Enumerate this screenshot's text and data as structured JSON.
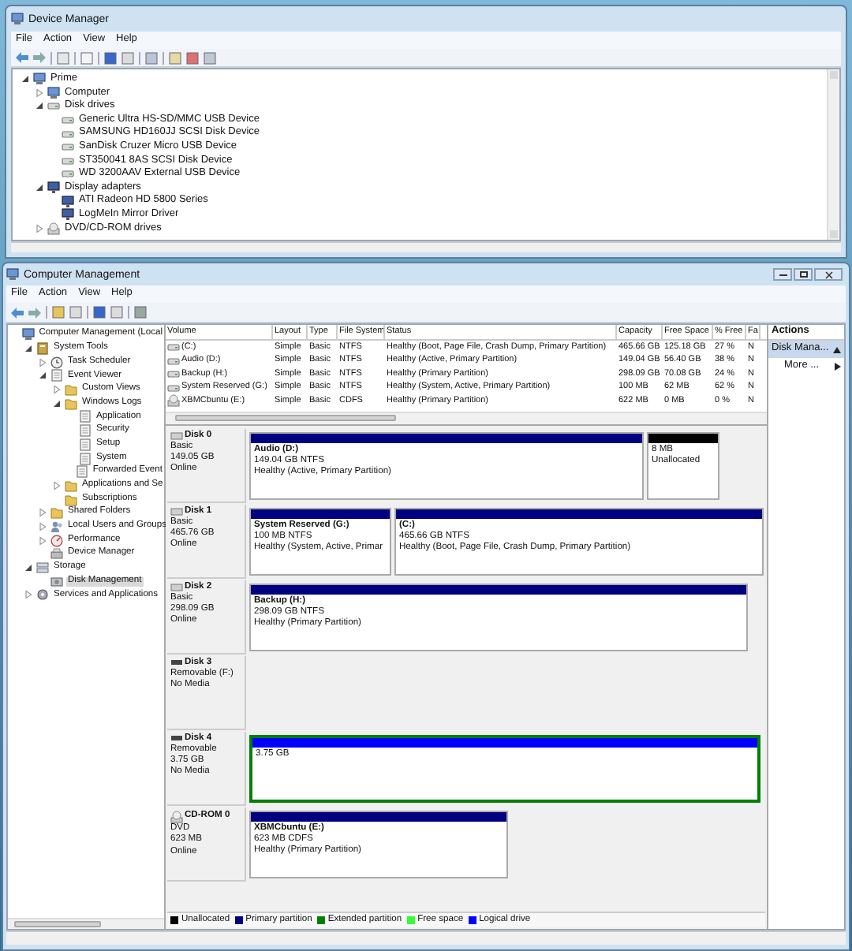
{
  "device_manager": {
    "title": "Device Manager",
    "menu": [
      "File",
      "Action",
      "View",
      "Help"
    ],
    "tree": [
      {
        "label": "Prime",
        "kind": "computer",
        "expanded": true,
        "children": [
          {
            "label": "Computer",
            "kind": "computer",
            "expanded": false
          },
          {
            "label": "Disk drives",
            "kind": "drive",
            "expanded": true,
            "children": [
              {
                "label": "Generic Ultra HS-SD/MMC USB Device",
                "kind": "drive"
              },
              {
                "label": "SAMSUNG HD160JJ SCSI Disk Device",
                "kind": "drive"
              },
              {
                "label": "SanDisk Cruzer Micro USB Device",
                "kind": "drive"
              },
              {
                "label": "ST350041 8AS SCSI Disk Device",
                "kind": "drive"
              },
              {
                "label": "WD 3200AAV External USB Device",
                "kind": "drive"
              }
            ]
          },
          {
            "label": "Display adapters",
            "kind": "monitor",
            "expanded": true,
            "children": [
              {
                "label": "ATI Radeon HD 5800 Series",
                "kind": "monitor"
              },
              {
                "label": "LogMeIn Mirror Driver",
                "kind": "monitor"
              }
            ]
          },
          {
            "label": "DVD/CD-ROM drives",
            "kind": "cdrom",
            "expanded": false
          }
        ]
      }
    ]
  },
  "computer_management": {
    "title": "Computer Management",
    "menu": [
      "File",
      "Action",
      "View",
      "Help"
    ],
    "tree": [
      {
        "label": "Computer Management (Local",
        "kind": "computer",
        "selected": false,
        "children": [
          {
            "label": "System Tools",
            "kind": "tools",
            "expanded": true,
            "selected": false,
            "children": [
              {
                "label": "Task Scheduler",
                "kind": "clock",
                "expanded": false,
                "selected": false
              },
              {
                "label": "Event Viewer",
                "kind": "log",
                "expanded": true,
                "selected": false,
                "children": [
                  {
                    "label": "Custom Views",
                    "kind": "folder",
                    "expanded": false,
                    "selected": false
                  },
                  {
                    "label": "Windows Logs",
                    "kind": "folder",
                    "expanded": true,
                    "selected": false,
                    "children": [
                      {
                        "label": "Application",
                        "kind": "log",
                        "selected": false
                      },
                      {
                        "label": "Security",
                        "kind": "log",
                        "selected": false
                      },
                      {
                        "label": "Setup",
                        "kind": "log",
                        "selected": false
                      },
                      {
                        "label": "System",
                        "kind": "log",
                        "selected": false
                      },
                      {
                        "label": "Forwarded Event",
                        "kind": "log",
                        "selected": false
                      }
                    ]
                  },
                  {
                    "label": "Applications and Se",
                    "kind": "folder",
                    "expanded": false,
                    "selected": false
                  },
                  {
                    "label": "Subscriptions",
                    "kind": "folder",
                    "selected": false
                  }
                ]
              },
              {
                "label": "Shared Folders",
                "kind": "folder",
                "expanded": false,
                "selected": false
              },
              {
                "label": "Local Users and Groups",
                "kind": "users",
                "expanded": false,
                "selected": false
              },
              {
                "label": "Performance",
                "kind": "gauge",
                "expanded": false,
                "selected": false
              },
              {
                "label": "Device Manager",
                "kind": "device",
                "selected": false
              }
            ]
          },
          {
            "label": "Storage",
            "kind": "storage",
            "expanded": true,
            "selected": false,
            "children": [
              {
                "label": "Disk Management",
                "kind": "disk",
                "selected": true
              }
            ]
          },
          {
            "label": "Services and Applications",
            "kind": "gear",
            "expanded": false,
            "selected": false
          }
        ]
      }
    ],
    "volumes": {
      "columns": [
        "Volume",
        "Layout",
        "Type",
        "File System",
        "Status",
        "Capacity",
        "Free Space",
        "% Free",
        "Fa"
      ],
      "rows": [
        {
          "kind": "drive",
          "cells": [
            "(C:)",
            "Simple",
            "Basic",
            "NTFS",
            "Healthy (Boot, Page File, Crash Dump, Primary Partition)",
            "465.66 GB",
            "125.18 GB",
            "27 %",
            "N"
          ]
        },
        {
          "kind": "drive",
          "cells": [
            "Audio (D:)",
            "Simple",
            "Basic",
            "NTFS",
            "Healthy (Active, Primary Partition)",
            "149.04 GB",
            "56.40 GB",
            "38 %",
            "N"
          ]
        },
        {
          "kind": "drive",
          "cells": [
            "Backup (H:)",
            "Simple",
            "Basic",
            "NTFS",
            "Healthy (Primary Partition)",
            "298.09 GB",
            "70.08 GB",
            "24 %",
            "N"
          ]
        },
        {
          "kind": "drive",
          "cells": [
            "System Reserved (G:)",
            "Simple",
            "Basic",
            "NTFS",
            "Healthy (System, Active, Primary Partition)",
            "100 MB",
            "62 MB",
            "62 %",
            "N"
          ]
        },
        {
          "kind": "cdrom",
          "cells": [
            "XBMCbuntu (E:)",
            "Simple",
            "Basic",
            "CDFS",
            "Healthy (Primary Partition)",
            "622 MB",
            "0 MB",
            "0 %",
            "N"
          ]
        }
      ]
    },
    "disks": [
      {
        "name": "Disk 0",
        "kind": "basic",
        "lines": [
          "Basic",
          "149.05 GB",
          "Online"
        ],
        "partitions": [
          {
            "kind": "primary",
            "title": "Audio  (D:)",
            "lines": [
              "149.04 GB NTFS",
              "Healthy (Active, Primary Partition)"
            ]
          },
          {
            "kind": "unallocated",
            "lines": [
              "8 MB",
              "Unallocated"
            ]
          }
        ]
      },
      {
        "name": "Disk 1",
        "kind": "basic",
        "lines": [
          "Basic",
          "465.76 GB",
          "Online"
        ],
        "partitions": [
          {
            "kind": "primary",
            "title": "System Reserved  (G:)",
            "lines": [
              "100 MB NTFS",
              "Healthy (System, Active, Primar"
            ]
          },
          {
            "kind": "primary",
            "title": "(C:)",
            "lines": [
              "465.66 GB NTFS",
              "Healthy (Boot, Page File, Crash Dump, Primary Partition)"
            ]
          }
        ]
      },
      {
        "name": "Disk 2",
        "kind": "basic",
        "lines": [
          "Basic",
          "298.09 GB",
          "Online"
        ],
        "partitions": [
          {
            "kind": "primary",
            "title": "Backup  (H:)",
            "lines": [
              "298.09 GB NTFS",
              "Healthy (Primary Partition)"
            ]
          }
        ]
      },
      {
        "name": "Disk 3",
        "kind": "removable",
        "lines": [
          "Removable (F:)",
          "No Media"
        ]
      },
      {
        "name": "Disk 4",
        "kind": "removable",
        "lines": [
          "Removable",
          "3.75 GB",
          "No Media"
        ],
        "partitions": [
          {
            "kind": "logical",
            "lines": [
              "3.75 GB"
            ]
          }
        ]
      },
      {
        "name": "CD-ROM 0",
        "kind": "cdrom",
        "lines": [
          "DVD",
          "623 MB",
          "Online"
        ],
        "partitions": [
          {
            "kind": "primary",
            "title": "XBMCbuntu  (E:)",
            "lines": [
              "623 MB CDFS",
              "Healthy (Primary Partition)"
            ]
          }
        ]
      }
    ],
    "legend": [
      {
        "label": "Unallocated",
        "color": "#000000"
      },
      {
        "label": "Primary partition",
        "color": "#000080"
      },
      {
        "label": "Extended partition",
        "color": "#008000"
      },
      {
        "label": "Free space",
        "color": "#33ff33"
      },
      {
        "label": "Logical drive",
        "color": "#0000ff"
      }
    ],
    "actions": {
      "title": "Actions",
      "items": [
        {
          "label": "Disk Mana...",
          "kind": "header",
          "selected": true
        },
        {
          "label": "More ...",
          "kind": "link",
          "selected": false
        }
      ]
    }
  }
}
